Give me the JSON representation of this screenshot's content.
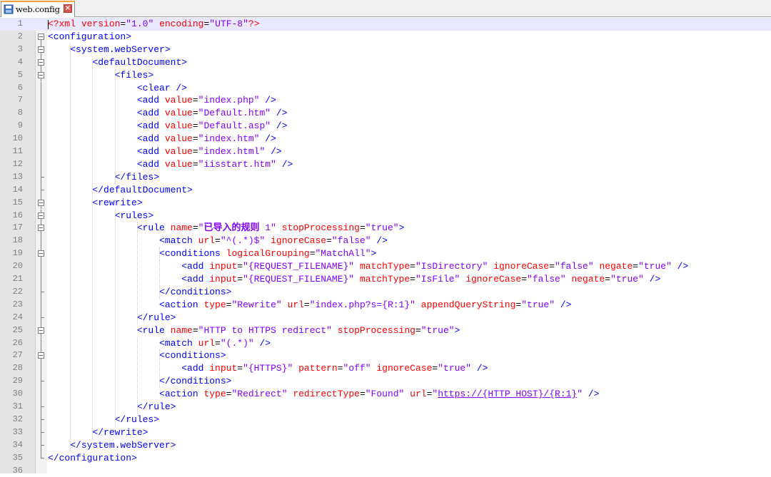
{
  "tab": {
    "label": "web.config",
    "icon": "file-icon",
    "close_icon": "close-icon"
  },
  "colors": {
    "tag": "#0000ff",
    "attribute": "#ff0000",
    "value": "#8000ff",
    "equals": "#000000",
    "line_number": "#808080",
    "current_line": "#e8e8ff"
  },
  "lines": [
    {
      "n": "1",
      "fold": "none",
      "tokens": [
        [
          "d",
          "<?xml "
        ],
        [
          "a",
          "version"
        ],
        [
          "e",
          "="
        ],
        [
          "v",
          "\"1.0\""
        ],
        [
          "d",
          " "
        ],
        [
          "a",
          "encoding"
        ],
        [
          "e",
          "="
        ],
        [
          "v",
          "\"UTF-8\""
        ],
        [
          "d",
          "?>"
        ]
      ]
    },
    {
      "n": "2",
      "fold": "open",
      "tokens": [
        [
          "t",
          "<configuration>"
        ]
      ]
    },
    {
      "n": "3",
      "fold": "open",
      "tokens": [
        [
          "s",
          "    "
        ],
        [
          "t",
          "<system.webServer>"
        ]
      ]
    },
    {
      "n": "4",
      "fold": "open",
      "tokens": [
        [
          "s",
          "        "
        ],
        [
          "t",
          "<defaultDocument>"
        ]
      ]
    },
    {
      "n": "5",
      "fold": "open",
      "tokens": [
        [
          "s",
          "            "
        ],
        [
          "t",
          "<files>"
        ]
      ]
    },
    {
      "n": "6",
      "fold": "line",
      "tokens": [
        [
          "s",
          "                "
        ],
        [
          "t",
          "<clear />"
        ]
      ]
    },
    {
      "n": "7",
      "fold": "line",
      "tokens": [
        [
          "s",
          "                "
        ],
        [
          "t",
          "<add "
        ],
        [
          "a",
          "value"
        ],
        [
          "e",
          "="
        ],
        [
          "v",
          "\"index.php\""
        ],
        [
          "t",
          " />"
        ]
      ]
    },
    {
      "n": "8",
      "fold": "line",
      "tokens": [
        [
          "s",
          "                "
        ],
        [
          "t",
          "<add "
        ],
        [
          "a",
          "value"
        ],
        [
          "e",
          "="
        ],
        [
          "v",
          "\"Default.htm\""
        ],
        [
          "t",
          " />"
        ]
      ]
    },
    {
      "n": "9",
      "fold": "line",
      "tokens": [
        [
          "s",
          "                "
        ],
        [
          "t",
          "<add "
        ],
        [
          "a",
          "value"
        ],
        [
          "e",
          "="
        ],
        [
          "v",
          "\"Default.asp\""
        ],
        [
          "t",
          " />"
        ]
      ]
    },
    {
      "n": "10",
      "fold": "line",
      "tokens": [
        [
          "s",
          "                "
        ],
        [
          "t",
          "<add "
        ],
        [
          "a",
          "value"
        ],
        [
          "e",
          "="
        ],
        [
          "v",
          "\"index.htm\""
        ],
        [
          "t",
          " />"
        ]
      ]
    },
    {
      "n": "11",
      "fold": "line",
      "tokens": [
        [
          "s",
          "                "
        ],
        [
          "t",
          "<add "
        ],
        [
          "a",
          "value"
        ],
        [
          "e",
          "="
        ],
        [
          "v",
          "\"index.html\""
        ],
        [
          "t",
          " />"
        ]
      ]
    },
    {
      "n": "12",
      "fold": "line",
      "tokens": [
        [
          "s",
          "                "
        ],
        [
          "t",
          "<add "
        ],
        [
          "a",
          "value"
        ],
        [
          "e",
          "="
        ],
        [
          "v",
          "\"iisstart.htm\""
        ],
        [
          "t",
          " />"
        ]
      ]
    },
    {
      "n": "13",
      "fold": "end",
      "tokens": [
        [
          "s",
          "            "
        ],
        [
          "t",
          "</files>"
        ]
      ]
    },
    {
      "n": "14",
      "fold": "end",
      "tokens": [
        [
          "s",
          "        "
        ],
        [
          "t",
          "</defaultDocument>"
        ]
      ]
    },
    {
      "n": "15",
      "fold": "open",
      "tokens": [
        [
          "s",
          "        "
        ],
        [
          "t",
          "<rewrite>"
        ]
      ]
    },
    {
      "n": "16",
      "fold": "open",
      "tokens": [
        [
          "s",
          "            "
        ],
        [
          "t",
          "<rules>"
        ]
      ]
    },
    {
      "n": "17",
      "fold": "open",
      "tokens": [
        [
          "s",
          "                "
        ],
        [
          "t",
          "<rule "
        ],
        [
          "a",
          "name"
        ],
        [
          "e",
          "="
        ],
        [
          "v",
          "\""
        ],
        [
          "b",
          "已导入的规则"
        ],
        [
          "v",
          " 1\""
        ],
        [
          "t",
          " "
        ],
        [
          "a",
          "stopProcessing"
        ],
        [
          "e",
          "="
        ],
        [
          "v",
          "\"true\""
        ],
        [
          "t",
          ">"
        ]
      ]
    },
    {
      "n": "18",
      "fold": "line",
      "tokens": [
        [
          "s",
          "                    "
        ],
        [
          "t",
          "<match "
        ],
        [
          "a",
          "url"
        ],
        [
          "e",
          "="
        ],
        [
          "v",
          "\"^(.*)$\""
        ],
        [
          "t",
          " "
        ],
        [
          "a",
          "ignoreCase"
        ],
        [
          "e",
          "="
        ],
        [
          "v",
          "\"false\""
        ],
        [
          "t",
          " />"
        ]
      ]
    },
    {
      "n": "19",
      "fold": "open",
      "tokens": [
        [
          "s",
          "                    "
        ],
        [
          "t",
          "<conditions "
        ],
        [
          "a",
          "logicalGrouping"
        ],
        [
          "e",
          "="
        ],
        [
          "v",
          "\"MatchAll\""
        ],
        [
          "t",
          ">"
        ]
      ]
    },
    {
      "n": "20",
      "fold": "line",
      "tokens": [
        [
          "s",
          "                        "
        ],
        [
          "t",
          "<add "
        ],
        [
          "a",
          "input"
        ],
        [
          "e",
          "="
        ],
        [
          "v",
          "\"{REQUEST_FILENAME}\""
        ],
        [
          "t",
          " "
        ],
        [
          "a",
          "matchType"
        ],
        [
          "e",
          "="
        ],
        [
          "v",
          "\"IsDirectory\""
        ],
        [
          "t",
          " "
        ],
        [
          "a",
          "ignoreCase"
        ],
        [
          "e",
          "="
        ],
        [
          "v",
          "\"false\""
        ],
        [
          "t",
          " "
        ],
        [
          "a",
          "negate"
        ],
        [
          "e",
          "="
        ],
        [
          "v",
          "\"true\""
        ],
        [
          "t",
          " />"
        ]
      ]
    },
    {
      "n": "21",
      "fold": "line",
      "tokens": [
        [
          "s",
          "                        "
        ],
        [
          "t",
          "<add "
        ],
        [
          "a",
          "input"
        ],
        [
          "e",
          "="
        ],
        [
          "v",
          "\"{REQUEST_FILENAME}\""
        ],
        [
          "t",
          " "
        ],
        [
          "a",
          "matchType"
        ],
        [
          "e",
          "="
        ],
        [
          "v",
          "\"IsFile\""
        ],
        [
          "t",
          " "
        ],
        [
          "a",
          "ignoreCase"
        ],
        [
          "e",
          "="
        ],
        [
          "v",
          "\"false\""
        ],
        [
          "t",
          " "
        ],
        [
          "a",
          "negate"
        ],
        [
          "e",
          "="
        ],
        [
          "v",
          "\"true\""
        ],
        [
          "t",
          " />"
        ]
      ]
    },
    {
      "n": "22",
      "fold": "end",
      "tokens": [
        [
          "s",
          "                    "
        ],
        [
          "t",
          "</conditions>"
        ]
      ]
    },
    {
      "n": "23",
      "fold": "line",
      "tokens": [
        [
          "s",
          "                    "
        ],
        [
          "t",
          "<action "
        ],
        [
          "a",
          "type"
        ],
        [
          "e",
          "="
        ],
        [
          "v",
          "\"Rewrite\""
        ],
        [
          "t",
          " "
        ],
        [
          "a",
          "url"
        ],
        [
          "e",
          "="
        ],
        [
          "v",
          "\"index.php?s={R:1}\""
        ],
        [
          "t",
          " "
        ],
        [
          "a",
          "appendQueryString"
        ],
        [
          "e",
          "="
        ],
        [
          "v",
          "\"true\""
        ],
        [
          "t",
          " />"
        ]
      ]
    },
    {
      "n": "24",
      "fold": "end",
      "tokens": [
        [
          "s",
          "                "
        ],
        [
          "t",
          "</rule>"
        ]
      ]
    },
    {
      "n": "25",
      "fold": "open",
      "tokens": [
        [
          "s",
          "                "
        ],
        [
          "t",
          "<rule "
        ],
        [
          "a",
          "name"
        ],
        [
          "e",
          "="
        ],
        [
          "v",
          "\"HTTP to HTTPS redirect\""
        ],
        [
          "t",
          " "
        ],
        [
          "a",
          "stopProcessing"
        ],
        [
          "e",
          "="
        ],
        [
          "v",
          "\"true\""
        ],
        [
          "t",
          ">"
        ]
      ]
    },
    {
      "n": "26",
      "fold": "line",
      "tokens": [
        [
          "s",
          "                    "
        ],
        [
          "t",
          "<match "
        ],
        [
          "a",
          "url"
        ],
        [
          "e",
          "="
        ],
        [
          "v",
          "\"(.*)\""
        ],
        [
          "t",
          " />"
        ]
      ]
    },
    {
      "n": "27",
      "fold": "open",
      "tokens": [
        [
          "s",
          "                    "
        ],
        [
          "t",
          "<conditions>"
        ]
      ]
    },
    {
      "n": "28",
      "fold": "line",
      "tokens": [
        [
          "s",
          "                        "
        ],
        [
          "t",
          "<add "
        ],
        [
          "a",
          "input"
        ],
        [
          "e",
          "="
        ],
        [
          "v",
          "\"{HTTPS}\""
        ],
        [
          "t",
          " "
        ],
        [
          "a",
          "pattern"
        ],
        [
          "e",
          "="
        ],
        [
          "v",
          "\"off\""
        ],
        [
          "t",
          " "
        ],
        [
          "a",
          "ignoreCase"
        ],
        [
          "e",
          "="
        ],
        [
          "v",
          "\"true\""
        ],
        [
          "t",
          " />"
        ]
      ]
    },
    {
      "n": "29",
      "fold": "end",
      "tokens": [
        [
          "s",
          "                    "
        ],
        [
          "t",
          "</conditions>"
        ]
      ]
    },
    {
      "n": "30",
      "fold": "line",
      "tokens": [
        [
          "s",
          "                    "
        ],
        [
          "t",
          "<action "
        ],
        [
          "a",
          "type"
        ],
        [
          "e",
          "="
        ],
        [
          "v",
          "\"Redirect\""
        ],
        [
          "t",
          " "
        ],
        [
          "a",
          "redirectType"
        ],
        [
          "e",
          "="
        ],
        [
          "v",
          "\"Found\""
        ],
        [
          "t",
          " "
        ],
        [
          "a",
          "url"
        ],
        [
          "e",
          "="
        ],
        [
          "v",
          "\""
        ],
        [
          "l",
          "https://{HTTP_HOST}/{R:1}"
        ],
        [
          "v",
          "\""
        ],
        [
          "t",
          " />"
        ]
      ]
    },
    {
      "n": "31",
      "fold": "end",
      "tokens": [
        [
          "s",
          "                "
        ],
        [
          "t",
          "</rule>"
        ]
      ]
    },
    {
      "n": "32",
      "fold": "end",
      "tokens": [
        [
          "s",
          "            "
        ],
        [
          "t",
          "</rules>"
        ]
      ]
    },
    {
      "n": "33",
      "fold": "end",
      "tokens": [
        [
          "s",
          "        "
        ],
        [
          "t",
          "</rewrite>"
        ]
      ]
    },
    {
      "n": "34",
      "fold": "end",
      "tokens": [
        [
          "s",
          "    "
        ],
        [
          "t",
          "</system.webServer>"
        ]
      ]
    },
    {
      "n": "35",
      "fold": "end",
      "tokens": [
        [
          "t",
          "</configuration>"
        ]
      ]
    },
    {
      "n": "36",
      "fold": "none",
      "tokens": []
    }
  ]
}
